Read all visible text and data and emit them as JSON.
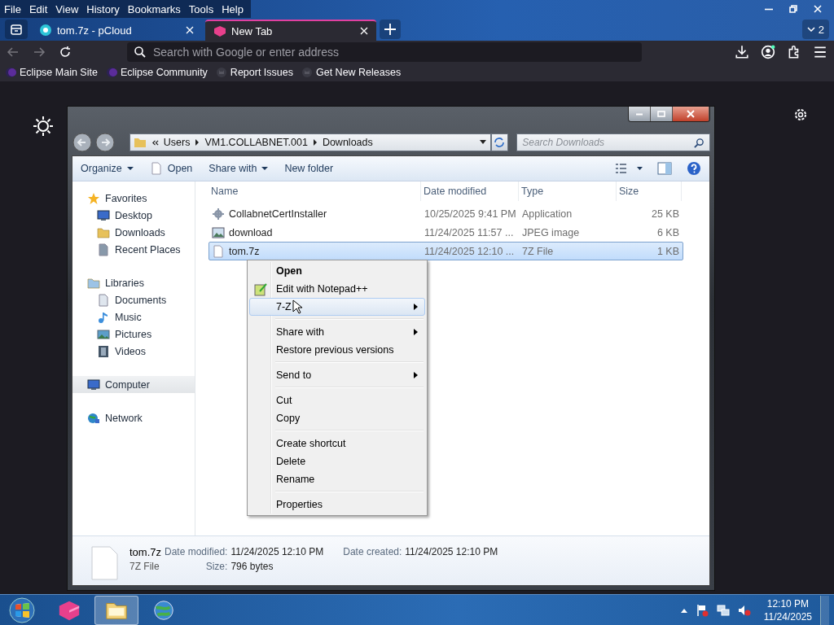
{
  "browser": {
    "menu_bar": [
      "File",
      "Edit",
      "View",
      "History",
      "Bookmarks",
      "Tools",
      "Help"
    ],
    "tabs": [
      {
        "title": "tom.7z - pCloud",
        "selected": false
      },
      {
        "title": "New Tab",
        "selected": true
      }
    ],
    "tab_count": "2",
    "address": {
      "placeholder": "Search with Google or enter address"
    },
    "bookmarks": [
      "Eclipse Main Site",
      "Eclipse Community",
      "Report Issues",
      "Get New Releases"
    ]
  },
  "explorer": {
    "breadcrumb": [
      "Users",
      "VM1.COLLABNET.001",
      "Downloads"
    ],
    "search": {
      "placeholder": "Search Downloads"
    },
    "toolbar": [
      "Organize",
      "Open",
      "Share with",
      "New folder"
    ],
    "nav": [
      {
        "label": "Favorites",
        "selected": false,
        "children": [
          {
            "label": "Desktop",
            "selected": false
          },
          {
            "label": "Downloads",
            "selected": false
          },
          {
            "label": "Recent Places",
            "selected": false
          }
        ]
      },
      {
        "label": "Libraries",
        "selected": false,
        "children": [
          {
            "label": "Documents",
            "selected": false
          },
          {
            "label": "Music",
            "selected": false
          },
          {
            "label": "Pictures",
            "selected": false
          },
          {
            "label": "Videos",
            "selected": false
          }
        ]
      },
      {
        "label": "Computer",
        "selected": true
      },
      {
        "label": "Network",
        "selected": false
      }
    ],
    "columns": [
      "Name",
      "Date modified",
      "Type",
      "Size"
    ],
    "rows": [
      {
        "cells": [
          "CollabnetCertInstaller",
          "10/25/2025 9:41 PM",
          "Application",
          "25 KB"
        ],
        "selected": false
      },
      {
        "cells": [
          "download",
          "11/24/2025 11:57 ...",
          "JPEG image",
          "6 KB"
        ],
        "selected": false
      },
      {
        "cells": [
          "tom.7z",
          "11/24/2025 12:10 ...",
          "7Z File",
          "1 KB"
        ],
        "selected": true
      }
    ],
    "context_menu": [
      {
        "kind": "item",
        "label": "Open",
        "bold": true,
        "submenu": false,
        "selected": false
      },
      {
        "kind": "item",
        "label": "Edit with Notepad++",
        "bold": false,
        "submenu": false,
        "selected": false
      },
      {
        "kind": "item",
        "label": "7-Z",
        "bold": false,
        "submenu": true,
        "selected": true
      },
      {
        "kind": "separator"
      },
      {
        "kind": "item",
        "label": "Share with",
        "bold": false,
        "submenu": true,
        "selected": false
      },
      {
        "kind": "item",
        "label": "Restore previous versions",
        "bold": false,
        "submenu": false,
        "selected": false
      },
      {
        "kind": "separator"
      },
      {
        "kind": "item",
        "label": "Send to",
        "bold": false,
        "submenu": true,
        "selected": false
      },
      {
        "kind": "separator"
      },
      {
        "kind": "item",
        "label": "Cut",
        "bold": false,
        "submenu": false,
        "selected": false
      },
      {
        "kind": "item",
        "label": "Copy",
        "bold": false,
        "submenu": false,
        "selected": false
      },
      {
        "kind": "separator"
      },
      {
        "kind": "item",
        "label": "Create shortcut",
        "bold": false,
        "submenu": false,
        "selected": false
      },
      {
        "kind": "item",
        "label": "Delete",
        "bold": false,
        "submenu": false,
        "selected": false
      },
      {
        "kind": "item",
        "label": "Rename",
        "bold": false,
        "submenu": false,
        "selected": false
      },
      {
        "kind": "separator"
      },
      {
        "kind": "item",
        "label": "Properties",
        "bold": false,
        "submenu": false,
        "selected": false
      }
    ],
    "details": {
      "name": "tom.7z",
      "type": "7Z File",
      "fields": [
        {
          "label": "Date modified:",
          "value": "11/24/2025 12:10 PM"
        },
        {
          "label": "Date created:",
          "value": "11/24/2025 12:10 PM"
        },
        {
          "label": "Size:",
          "value": "796 bytes"
        }
      ]
    }
  },
  "taskbar": {
    "time": "12:10 PM",
    "date": "11/24/2025"
  }
}
